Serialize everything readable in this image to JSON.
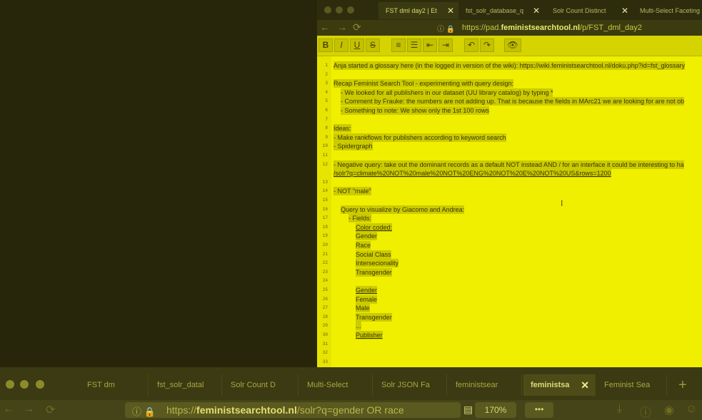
{
  "top_window": {
    "tabs": [
      {
        "label": "FST dml day2 | Et",
        "active": true,
        "close": "✕"
      },
      {
        "label": "fst_solr_database_q",
        "active": false,
        "close": "✕"
      },
      {
        "label": "Solr Count Distinct",
        "active": false,
        "close": "✕"
      },
      {
        "label": "Multi-Select Faceting",
        "active": false,
        "close": ""
      }
    ],
    "url_prefix": "https://pad.",
    "url_domain": "feministsearchtool.nl",
    "url_path": "/p/FST_dml_day2",
    "toolbar": [
      "B",
      "I",
      "U",
      "S",
      "≡",
      "☰",
      "⇤",
      "⇥",
      "↶",
      "↷",
      "👁"
    ],
    "editor_lines": [
      {
        "n": "1",
        "text": "Anja started a glossary here (in the logged in version of the wiki): https://wiki.feministsearchtool.nl/doku.php?id=fst_glossary",
        "indent": 0
      },
      {
        "n": "2",
        "text": "",
        "indent": 0
      },
      {
        "n": "3",
        "text": "Recap Feminist Search Tool - experimenting with query design:",
        "indent": 0
      },
      {
        "n": "4",
        "text": "- We looked for all publishers in our dataset (UU library catalog) by typing *",
        "indent": 10
      },
      {
        "n": "5",
        "text": "- Comment by Frauke: the numbers are not adding up. That is because the fields in MArc21 we are looking for are not ob",
        "indent": 10
      },
      {
        "n": "6",
        "text": "- Something to note: We show only the 1st 100 rows",
        "indent": 10
      },
      {
        "n": "7",
        "text": "",
        "indent": 0
      },
      {
        "n": "8",
        "text": "Ideas:",
        "indent": 0
      },
      {
        "n": "9",
        "text": "- Make rankflows for publishers according to keyword search",
        "indent": 0
      },
      {
        "n": "10",
        "text": "- Spidergraph",
        "indent": 0
      },
      {
        "n": "11",
        "text": "",
        "indent": 0
      },
      {
        "n": "12",
        "text": "- Negative query: take out the dominant records as a default NOT instead AND / for an interface it could be interesting to ha",
        "indent": 0
      },
      {
        "n": "",
        "text": "/solr?q=climate%20NOT%20male%20NOT%20ENG%20NOT%20E%20NOT%20US&rows=1200",
        "indent": 0,
        "underline": true
      },
      {
        "n": "13",
        "text": "",
        "indent": 0
      },
      {
        "n": "14",
        "text": "- NOT \"male\"",
        "indent": 0
      },
      {
        "n": "15",
        "text": "",
        "indent": 0
      },
      {
        "n": "16",
        "text": "Query to visualize by Giacomo and Andrea:",
        "indent": 10
      },
      {
        "n": "17",
        "text": "- Fields:",
        "indent": 21
      },
      {
        "n": "18",
        "text": "Color coded:",
        "indent": 31,
        "underline": true
      },
      {
        "n": "19",
        "text": "Gender",
        "indent": 31
      },
      {
        "n": "20",
        "text": "Race",
        "indent": 31
      },
      {
        "n": "21",
        "text": "Social Class",
        "indent": 31
      },
      {
        "n": "22",
        "text": "Intersecionality",
        "indent": 31
      },
      {
        "n": "23",
        "text": "Transgender",
        "indent": 31
      },
      {
        "n": "24",
        "text": "",
        "indent": 31
      },
      {
        "n": "25",
        "text": "Gender",
        "indent": 31,
        "underline": true
      },
      {
        "n": "26",
        "text": "Female",
        "indent": 31
      },
      {
        "n": "27",
        "text": "Male",
        "indent": 31
      },
      {
        "n": "28",
        "text": "Transgender",
        "indent": 31
      },
      {
        "n": "29",
        "text": "...",
        "indent": 31
      },
      {
        "n": "30",
        "text": "Publisher",
        "indent": 31,
        "underline": true
      },
      {
        "n": "31",
        "text": "",
        "indent": 10
      },
      {
        "n": "32",
        "text": "",
        "indent": 10
      },
      {
        "n": "33",
        "text": "",
        "indent": 10
      }
    ]
  },
  "bottom_window": {
    "tabs": [
      {
        "label": "FST dm",
        "active": false
      },
      {
        "label": "fst_solr_datal",
        "active": false
      },
      {
        "label": "Solr Count D",
        "active": false
      },
      {
        "label": "Multi-Select",
        "active": false
      },
      {
        "label": "Solr JSON Fa",
        "active": false
      },
      {
        "label": "feministsear",
        "active": false
      },
      {
        "label": "feministsa",
        "active": true,
        "close": "✕"
      },
      {
        "label": "Feminist Sea",
        "active": false
      }
    ],
    "new_tab": "+",
    "url_prefix": "https://",
    "url_domain": "feministsearchtool.nl",
    "url_path": "/solr?q=gender OR race",
    "zoom": "170%",
    "more": "•••"
  },
  "colors": {
    "accent": "#e8e600",
    "dark": "#26250a"
  }
}
